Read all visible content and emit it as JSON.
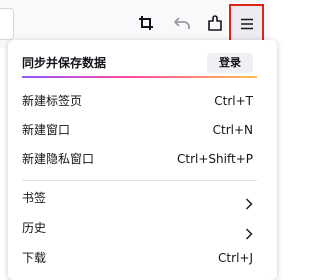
{
  "menu": {
    "sync": {
      "title": "同步并保存数据",
      "signin_label": "登录"
    },
    "items": [
      {
        "label": "新建标签页",
        "shortcut": "Ctrl+T"
      },
      {
        "label": "新建窗口",
        "shortcut": "Ctrl+N"
      },
      {
        "label": "新建隐私窗口",
        "shortcut": "Ctrl+Shift+P"
      },
      {
        "label": "书签"
      },
      {
        "label": "历史"
      },
      {
        "label": "下载",
        "shortcut": "Ctrl+J"
      }
    ]
  },
  "colors": {
    "highlight_border": "#e0201b",
    "gradient": [
      "#9059ff",
      "#ff4aa2",
      "#ffbd4f"
    ]
  },
  "icons": [
    "crop-icon",
    "back-arrow-icon",
    "extensions-icon",
    "hamburger-menu-icon",
    "chevron-right-icon"
  ]
}
